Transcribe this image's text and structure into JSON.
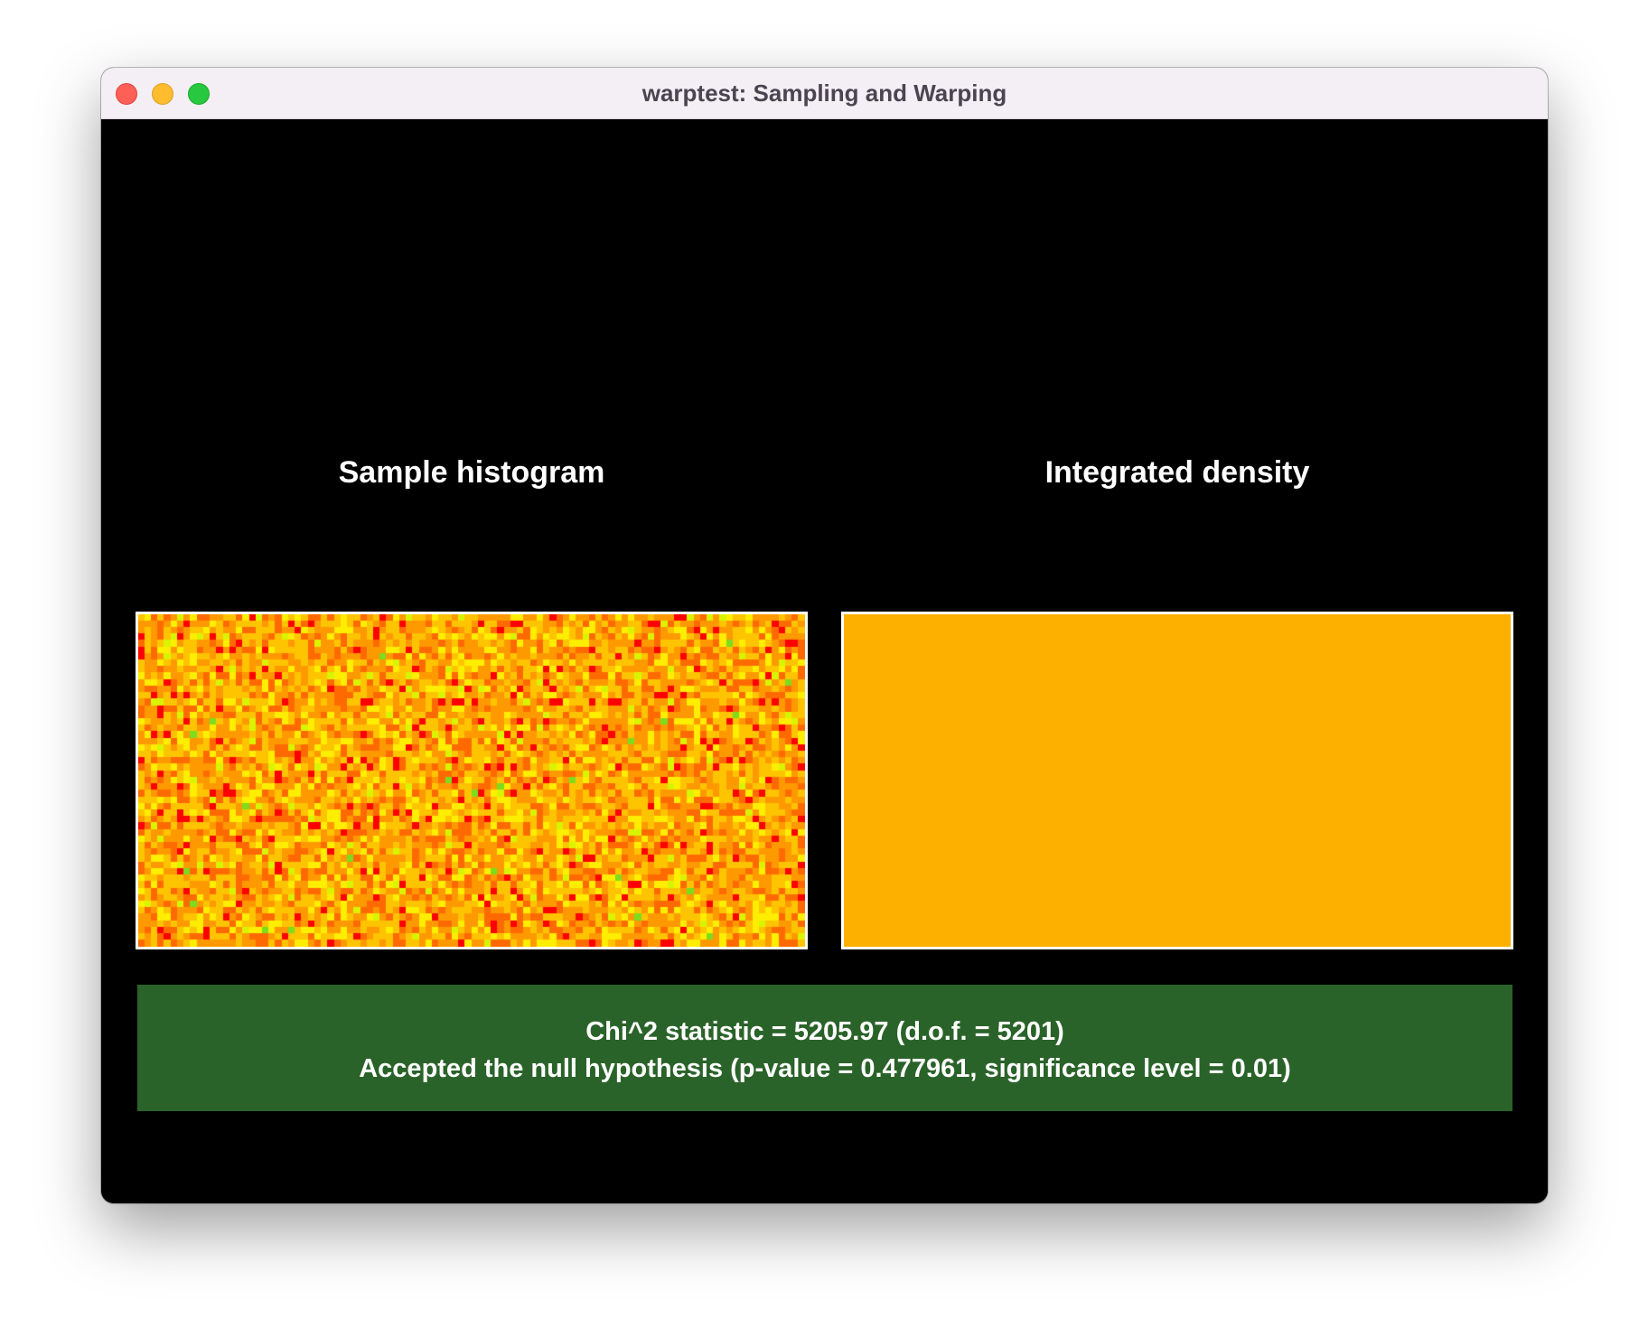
{
  "window": {
    "title": "warptest: Sampling and Warping"
  },
  "panels": {
    "left_title": "Sample histogram",
    "right_title": "Integrated density"
  },
  "histogram": {
    "colormap": [
      "#ff0000",
      "#ff6a00",
      "#ff9900",
      "#ffc400",
      "#ffee00",
      "#d9f400",
      "#7cdc1e"
    ],
    "density_color": "#fdb000"
  },
  "result": {
    "line1": "Chi^2 statistic = 5205.97 (d.o.f. = 5201)",
    "line2": "Accepted the null hypothesis (p-value = 0.477961, significance level = 0.01)",
    "background": "#2a6329"
  }
}
